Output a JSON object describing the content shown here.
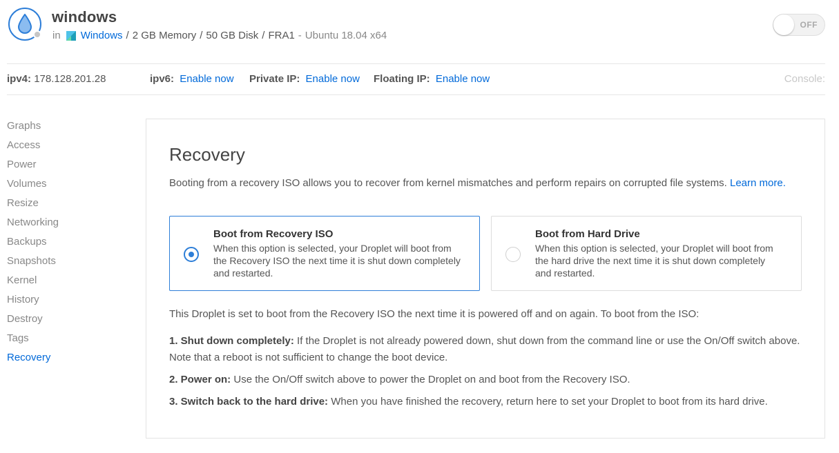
{
  "header": {
    "droplet_name": "windows",
    "in_label": "in",
    "project_name": "Windows",
    "memory": "2 GB Memory",
    "disk": "50 GB Disk",
    "region": "FRA1",
    "os": "Ubuntu 18.04 x64",
    "separator": "/",
    "dash": "-",
    "power_label": "OFF"
  },
  "ip_bar": {
    "ipv4_label": "ipv4:",
    "ipv4_value": "178.128.201.28",
    "ipv6_label": "ipv6:",
    "ipv6_link": "Enable now",
    "private_label": "Private IP:",
    "private_link": "Enable now",
    "floating_label": "Floating IP:",
    "floating_link": "Enable now",
    "console_label": "Console:"
  },
  "sidebar": {
    "items": [
      {
        "label": "Graphs"
      },
      {
        "label": "Access"
      },
      {
        "label": "Power"
      },
      {
        "label": "Volumes"
      },
      {
        "label": "Resize"
      },
      {
        "label": "Networking"
      },
      {
        "label": "Backups"
      },
      {
        "label": "Snapshots"
      },
      {
        "label": "Kernel"
      },
      {
        "label": "History"
      },
      {
        "label": "Destroy"
      },
      {
        "label": "Tags"
      },
      {
        "label": "Recovery"
      }
    ],
    "active": "Recovery"
  },
  "recovery": {
    "title": "Recovery",
    "description": "Booting from a recovery ISO allows you to recover from kernel mismatches and perform repairs on corrupted file systems.",
    "learn_more": "Learn more.",
    "options": [
      {
        "title": "Boot from Recovery ISO",
        "description": "When this option is selected, your Droplet will boot from the Recovery ISO the next time it is shut down completely and restarted.",
        "selected": true
      },
      {
        "title": "Boot from Hard Drive",
        "description": "When this option is selected, your Droplet will boot from the hard drive the next time it is shut down completely and restarted.",
        "selected": false
      }
    ],
    "status_text": "This Droplet is set to boot from the Recovery ISO the next time it is powered off and on again. To boot from the ISO:",
    "steps": [
      {
        "title": "1. Shut down completely:",
        "text": "If the Droplet is not already powered down, shut down from the command line or use the On/Off switch above. Note that a reboot is not sufficient to change the boot device."
      },
      {
        "title": "2. Power on:",
        "text": "Use the On/Off switch above to power the Droplet on and boot from the Recovery ISO."
      },
      {
        "title": "3. Switch back to the hard drive:",
        "text": "When you have finished the recovery, return here to set your Droplet to boot from its hard drive."
      }
    ]
  },
  "colors": {
    "accent": "#0069d9",
    "brand_blue": "#2d7ed8",
    "muted_text": "#888888"
  },
  "icons": {
    "droplet": "water-drop-icon",
    "project": "project-icon",
    "status": "status-dot-icon"
  }
}
